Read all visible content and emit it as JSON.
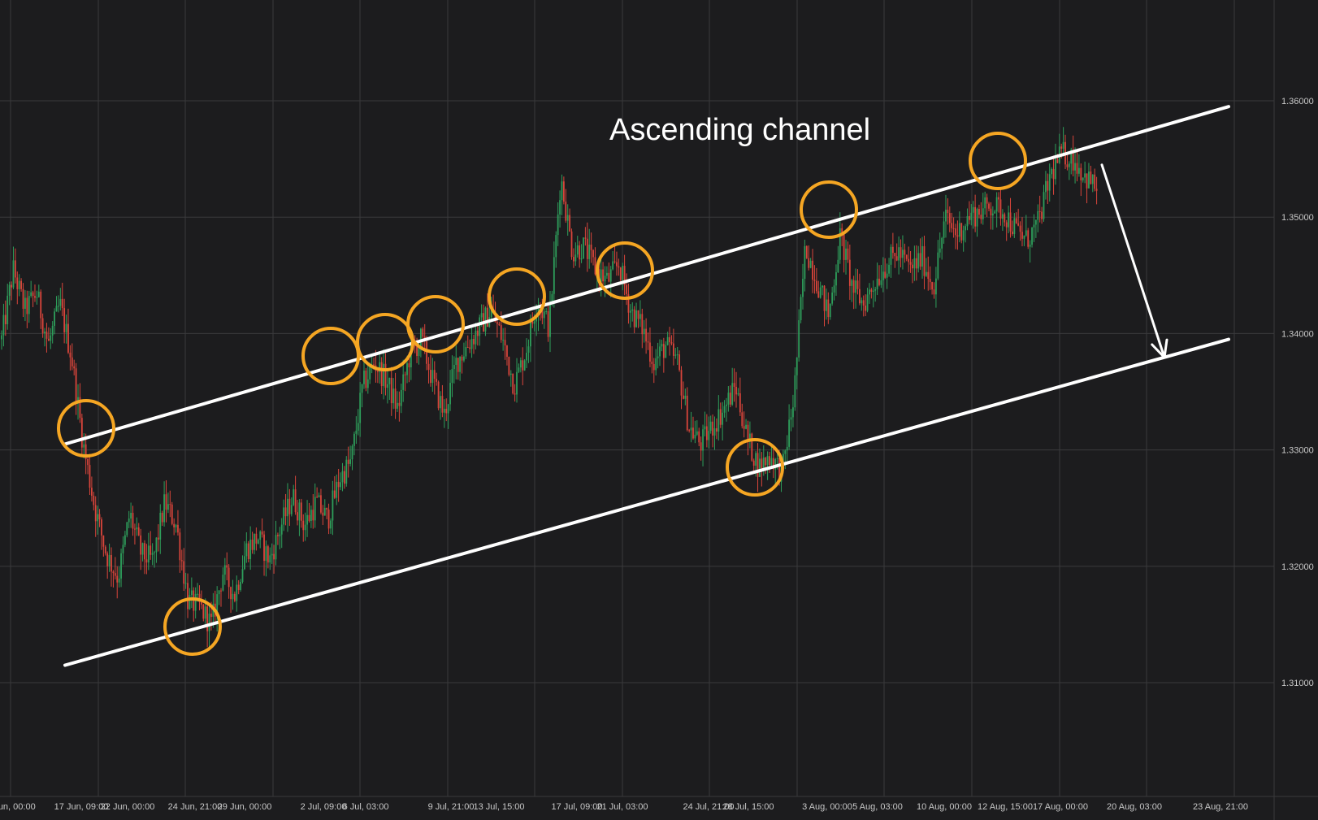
{
  "chart_data": {
    "type": "candlestick",
    "title": "Ascending channel",
    "ylim": [
      1.3,
      1.365
    ],
    "y_ticks": [
      "1.31000",
      "1.32000",
      "1.33000",
      "1.34000",
      "1.35000",
      "1.36000"
    ],
    "y_tick_values": [
      1.31,
      1.32,
      1.33,
      1.34,
      1.35,
      1.36
    ],
    "x_ticks": [
      "Jun, 00:00",
      "17 Jun, 09:00",
      "22 Jun, 00:00",
      "24 Jun, 21:00",
      "29 Jun, 00:00",
      "2 Jul, 09:00",
      "6 Jul, 03:00",
      "9 Jul, 21:00",
      "13 Jul, 15:00",
      "17 Jul, 09:00",
      "21 Jul, 03:00",
      "24 Jul, 21:00",
      "28 Jul, 15:00",
      "3 Aug, 00:00",
      "5 Aug, 03:00",
      "10 Aug, 00:00",
      "12 Aug, 15:00",
      "17 Aug, 00:00",
      "20 Aug, 03:00",
      "23 Aug, 21:00"
    ],
    "grid": true,
    "colors": {
      "background": "#1c1c1e",
      "grid": "#3a3a3c",
      "up": "#2e9e5b",
      "down": "#d9453b",
      "channel": "#ffffff",
      "touch": "#f5a623"
    },
    "price_path": [
      1.3395,
      1.3455,
      1.342,
      1.3435,
      1.339,
      1.3425,
      1.338,
      1.3305,
      1.325,
      1.321,
      1.319,
      1.3245,
      1.321,
      1.3205,
      1.3255,
      1.3235,
      1.317,
      1.3165,
      1.315,
      1.3195,
      1.3175,
      1.3215,
      1.3225,
      1.3205,
      1.3235,
      1.326,
      1.3235,
      1.3255,
      1.324,
      1.3275,
      1.329,
      1.3355,
      1.3375,
      1.336,
      1.3335,
      1.338,
      1.3395,
      1.336,
      1.333,
      1.3375,
      1.339,
      1.3405,
      1.342,
      1.3395,
      1.3355,
      1.3385,
      1.343,
      1.3405,
      1.3535,
      1.347,
      1.3475,
      1.3455,
      1.3445,
      1.346,
      1.342,
      1.3405,
      1.3375,
      1.339,
      1.3375,
      1.332,
      1.3305,
      1.332,
      1.3335,
      1.3355,
      1.331,
      1.3285,
      1.3295,
      1.328,
      1.3345,
      1.3475,
      1.3445,
      1.3415,
      1.3485,
      1.344,
      1.3425,
      1.3445,
      1.346,
      1.347,
      1.3455,
      1.3465,
      1.344,
      1.35,
      1.3485,
      1.35,
      1.3505,
      1.351,
      1.3505,
      1.349,
      1.348,
      1.3495,
      1.3535,
      1.3555,
      1.355,
      1.3535,
      1.3525
    ]
  },
  "annotations": {
    "channel_upper": [
      [
        1.3305,
        1.3595
      ]
    ],
    "channel_lower": [
      [
        1.3115,
        1.3395
      ]
    ],
    "arrow": {
      "from_price": 1.3545,
      "to_price": 1.3385
    }
  }
}
